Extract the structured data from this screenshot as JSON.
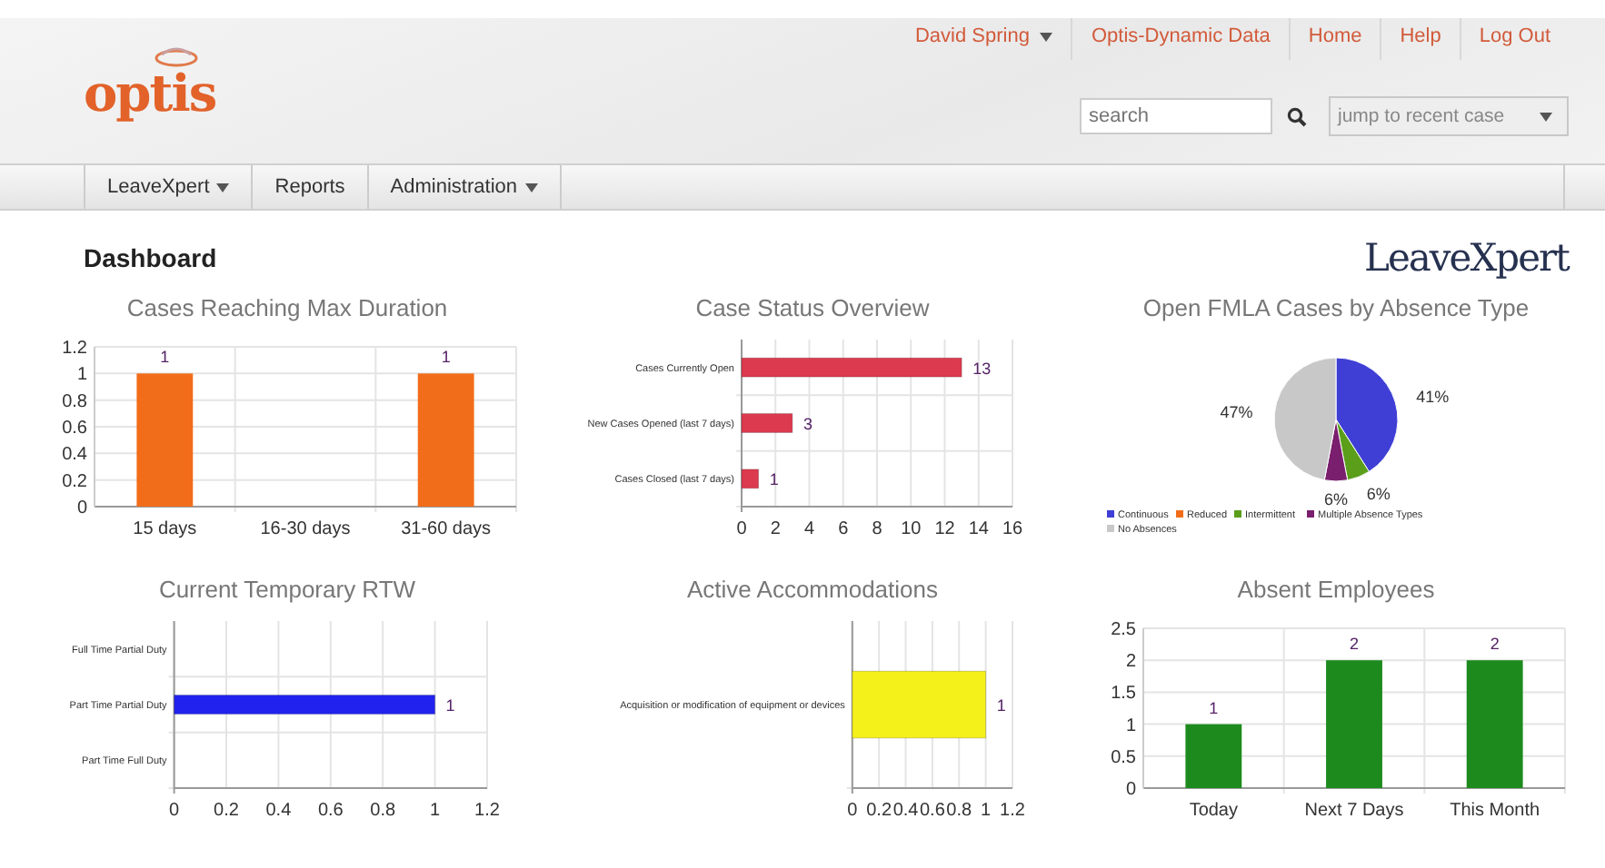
{
  "header": {
    "logo": "optis",
    "top_links": [
      {
        "label": "David Spring",
        "has_menu": true
      },
      {
        "label": "Optis-Dynamic Data",
        "has_menu": false
      },
      {
        "label": "Home",
        "has_menu": false
      },
      {
        "label": "Help",
        "has_menu": false
      },
      {
        "label": "Log Out",
        "has_menu": false
      }
    ],
    "search": {
      "placeholder": "search"
    },
    "recent_case": {
      "placeholder": "jump to recent case"
    }
  },
  "nav": [
    {
      "label": "LeaveXpert",
      "has_menu": true
    },
    {
      "label": "Reports",
      "has_menu": false
    },
    {
      "label": "Administration",
      "has_menu": true
    }
  ],
  "page": {
    "title": "Dashboard",
    "brand": "LeaveXpert"
  },
  "panels": [
    {
      "title": "Cases Reaching Max Duration",
      "chart_data": {
        "type": "bar",
        "orientation": "vertical",
        "categories": [
          "15 days",
          "16-30 days",
          "31-60 days"
        ],
        "series": [
          {
            "color": "#f26d1a",
            "values": [
              1,
              0,
              1
            ]
          }
        ],
        "ylim": [
          0,
          1.2
        ],
        "yticks": [
          0,
          0.2,
          0.4,
          0.6,
          0.8,
          1,
          1.2
        ],
        "grid": true,
        "value_labels": [
          "1",
          null,
          "1"
        ]
      }
    },
    {
      "title": "Case Status Overview",
      "chart_data": {
        "type": "bar",
        "orientation": "horizontal",
        "categories": [
          "Cases Currently Open",
          "New Cases Opened (last 7 days)",
          "Cases Closed (last 7 days)"
        ],
        "series": [
          {
            "color": "#dc3a4e",
            "values": [
              13,
              3,
              1
            ]
          }
        ],
        "xlim": [
          0,
          16
        ],
        "xticks": [
          0,
          2,
          4,
          6,
          8,
          10,
          12,
          14,
          16
        ],
        "grid": true,
        "value_labels": [
          "13",
          "3",
          "1"
        ]
      }
    },
    {
      "title": "Open FMLA Cases by Absence Type",
      "chart_data": {
        "type": "pie",
        "categories": [
          "Continuous",
          "Reduced",
          "Intermittent",
          "Multiple Absence Types",
          "No Absences"
        ],
        "series": [
          {
            "colors": [
              "#3f3fd6",
              "#f26d1a",
              "#5a9e1a",
              "#7a1f6e",
              "#c8c8c8"
            ],
            "values": [
              41,
              0,
              6,
              6,
              47
            ]
          }
        ],
        "value_labels": [
          "41%",
          null,
          "6%",
          "6%",
          "47%"
        ],
        "legend": "bottom"
      }
    },
    {
      "title": "Current Temporary RTW",
      "chart_data": {
        "type": "bar",
        "orientation": "horizontal",
        "categories": [
          "Full Time Partial Duty",
          "Part Time Partial Duty",
          "Part Time Full Duty"
        ],
        "series": [
          {
            "color": "#2222ee",
            "values": [
              0,
              1,
              0
            ]
          }
        ],
        "xlim": [
          0,
          1.2
        ],
        "xticks": [
          0,
          0.2,
          0.4,
          0.6,
          0.8,
          1,
          1.2
        ],
        "grid": true,
        "value_labels": [
          null,
          "1",
          null
        ]
      }
    },
    {
      "title": "Active Accommodations",
      "chart_data": {
        "type": "bar",
        "orientation": "horizontal",
        "categories": [
          "Acquisition or modification of equipment or devices"
        ],
        "series": [
          {
            "color": "#f4f01a",
            "values": [
              1
            ]
          }
        ],
        "xlim": [
          0,
          1.2
        ],
        "xticks": [
          0,
          0.2,
          0.4,
          0.6,
          0.8,
          1,
          1.2
        ],
        "grid": true,
        "value_labels": [
          "1"
        ]
      }
    },
    {
      "title": "Absent Employees",
      "chart_data": {
        "type": "bar",
        "orientation": "vertical",
        "categories": [
          "Today",
          "Next 7 Days",
          "This Month"
        ],
        "series": [
          {
            "color": "#1d8a1d",
            "values": [
              1,
              2,
              2
            ]
          }
        ],
        "ylim": [
          0,
          2.5
        ],
        "yticks": [
          0,
          0.5,
          1,
          1.5,
          2,
          2.5
        ],
        "grid": true,
        "value_labels": [
          "1",
          "2",
          "2"
        ]
      }
    }
  ]
}
